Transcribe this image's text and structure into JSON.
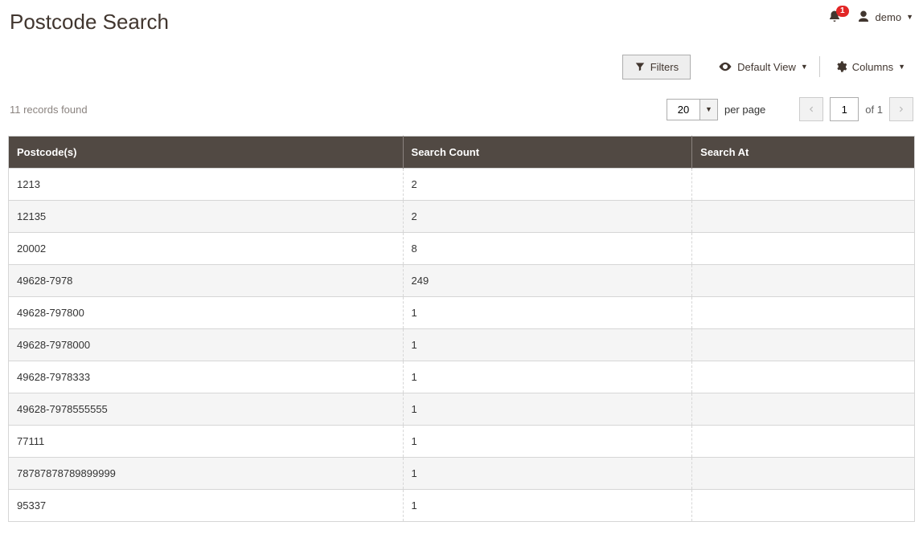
{
  "page_title": "Postcode Search",
  "user": {
    "name": "demo",
    "notification_count": "1"
  },
  "toolbar": {
    "filters_label": "Filters",
    "default_view_label": "Default View",
    "columns_label": "Columns"
  },
  "controls": {
    "records_found_text": "11 records found",
    "per_page_value": "20",
    "per_page_label": "per page",
    "page_value": "1",
    "of_label": "of",
    "total_pages": "1"
  },
  "table": {
    "headers": [
      "Postcode(s)",
      "Search Count",
      "Search At"
    ],
    "rows": [
      {
        "postcode": "1213",
        "count": "2",
        "at": ""
      },
      {
        "postcode": "12135",
        "count": "2",
        "at": ""
      },
      {
        "postcode": "20002",
        "count": "8",
        "at": ""
      },
      {
        "postcode": "49628-7978",
        "count": "249",
        "at": ""
      },
      {
        "postcode": "49628-797800",
        "count": "1",
        "at": ""
      },
      {
        "postcode": "49628-7978000",
        "count": "1",
        "at": ""
      },
      {
        "postcode": "49628-7978333",
        "count": "1",
        "at": ""
      },
      {
        "postcode": "49628-7978555555",
        "count": "1",
        "at": ""
      },
      {
        "postcode": "77111",
        "count": "1",
        "at": ""
      },
      {
        "postcode": "78787878789899999",
        "count": "1",
        "at": ""
      },
      {
        "postcode": "95337",
        "count": "1",
        "at": ""
      }
    ]
  }
}
